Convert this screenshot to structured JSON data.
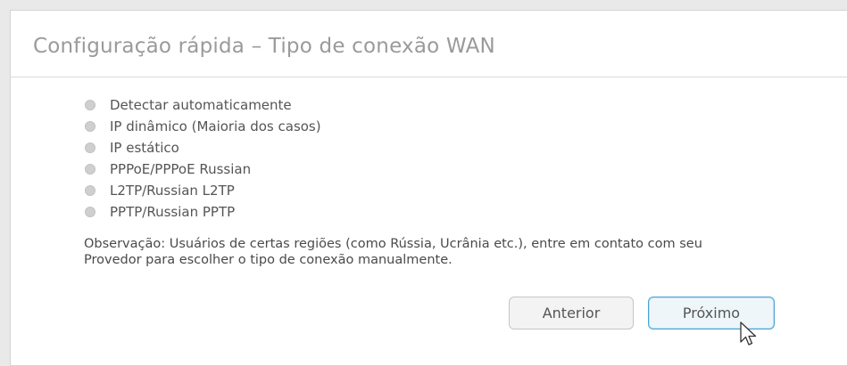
{
  "panel": {
    "title": "Configuração rápida – Tipo de conexão WAN"
  },
  "options": [
    {
      "label": "Detectar automaticamente",
      "selected": false
    },
    {
      "label": "IP dinâmico (Maioria dos casos)",
      "selected": false
    },
    {
      "label": "IP estático",
      "selected": false
    },
    {
      "label": "PPPoE/PPPoE Russian",
      "selected": false
    },
    {
      "label": "L2TP/Russian L2TP",
      "selected": false
    },
    {
      "label": "PPTP/Russian PPTP",
      "selected": false
    }
  ],
  "note": {
    "line1": "Observação: Usuários de certas regiões (como Rússia, Ucrânia etc.), entre em contato com seu",
    "line2": "Provedor para escolher o tipo de conexão manualmente."
  },
  "buttons": {
    "previous_label": "Anterior",
    "next_label": "Próximo"
  },
  "colors": {
    "title": "#9a9a9a",
    "radio_unselected": "#cfcfcf",
    "next_border": "#4aa3d4"
  },
  "icons": {
    "cursor": "mouse-pointer-icon"
  }
}
